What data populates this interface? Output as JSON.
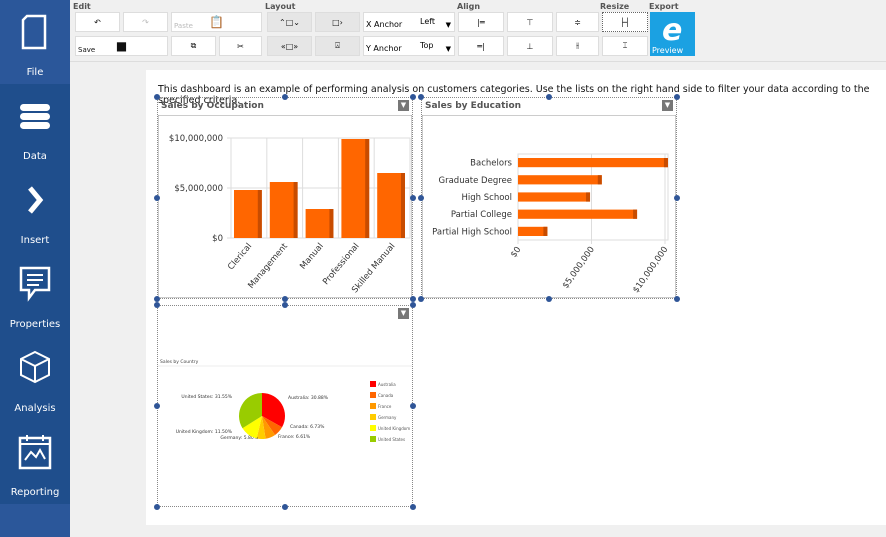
{
  "sidebar": {
    "items": [
      {
        "label": "File",
        "icon": "file-icon"
      },
      {
        "label": "Data",
        "icon": "database-icon"
      },
      {
        "label": "Insert",
        "icon": "chevron-right-icon"
      },
      {
        "label": "Properties",
        "icon": "comment-icon"
      },
      {
        "label": "Analysis",
        "icon": "cube-icon"
      },
      {
        "label": "Reporting",
        "icon": "calendar-chart-icon"
      }
    ]
  },
  "toolbar": {
    "groups": {
      "edit": "Edit",
      "layout": "Layout",
      "align": "Align",
      "resize": "Resize",
      "export": "Export"
    },
    "paste": "Paste",
    "save": "Save",
    "x_anchor": {
      "label": "X Anchor",
      "value": "Left"
    },
    "y_anchor": {
      "label": "Y Anchor",
      "value": "Top"
    },
    "preview": "Preview"
  },
  "description": "This dashboard is an example of performing analysis on customers categories. Use the lists on the right hand side to filter your data according to the specified criteria.",
  "accent": "#ff6600",
  "chart_data": [
    {
      "type": "bar",
      "title": "Sales by Occupation",
      "categories": [
        "Clerical",
        "Management",
        "Manual",
        "Professional",
        "Skilled Manual"
      ],
      "values": [
        4800000,
        5600000,
        2900000,
        9900000,
        6500000
      ],
      "ylim": [
        0,
        10000000
      ],
      "yticks": [
        "$0",
        "$5,000,000",
        "$10,000,000"
      ],
      "grid": true
    },
    {
      "type": "bar",
      "orientation": "horizontal",
      "title": "Sales by Education",
      "categories": [
        "Bachelors",
        "Graduate Degree",
        "High School",
        "Partial College",
        "Partial High School"
      ],
      "values": [
        10200000,
        5700000,
        4900000,
        8100000,
        2000000
      ],
      "xlim": [
        0,
        10000000
      ],
      "xticks": [
        "$0",
        "$5,000,000",
        "$10,000,000"
      ],
      "grid": true
    },
    {
      "type": "pie",
      "title": "Sales by Country",
      "categories": [
        "Australia",
        "Canada",
        "France",
        "Germany",
        "United Kingdom",
        "United States"
      ],
      "values": [
        30.88,
        6.73,
        6.61,
        5.8,
        11.5,
        31.55
      ],
      "labels": [
        "Australia: 30.88%",
        "Canada: 6.73%",
        "France: 6.61%",
        "Germany: 5.80%",
        "United Kingdom: 11.50%",
        "United States: 31.55%"
      ],
      "colors": [
        "#ff0000",
        "#ff6600",
        "#ff9900",
        "#ffcc00",
        "#ffff00",
        "#99cc00"
      ],
      "legend": "right"
    }
  ]
}
